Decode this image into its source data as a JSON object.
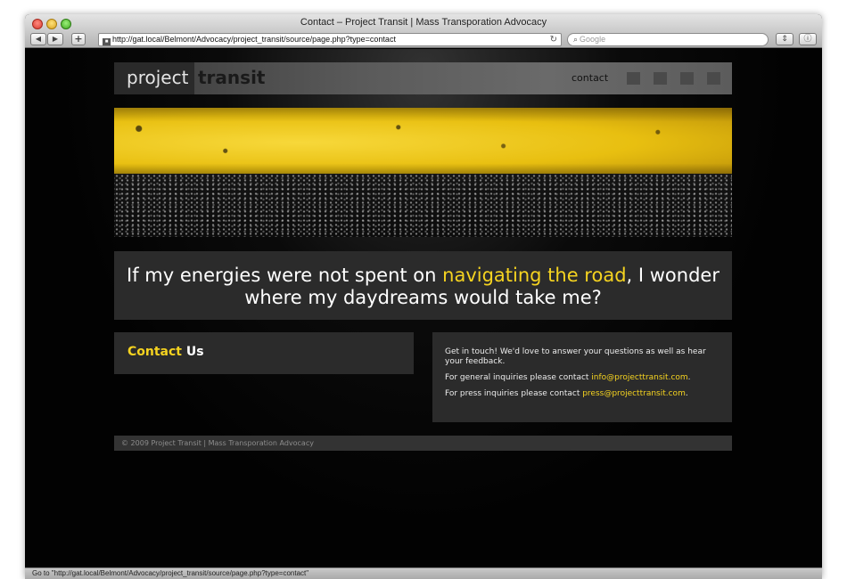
{
  "browser": {
    "window_title": "Contact – Project Transit | Mass Transporation Advocacy",
    "back_icon": "◀",
    "forward_icon": "▶",
    "add_bookmark_icon": "+",
    "url": "http://gat.local/Belmont/Advocacy/project_transit/source/page.php?type=contact",
    "search_placeholder": "Google",
    "status_text": "Go to \"http://gat.local/Belmont/Advocacy/project_transit/source/page.php?type=contact\""
  },
  "header": {
    "logo_word1": "project",
    "logo_word2": "transit",
    "nav_contact": "contact"
  },
  "quote": {
    "part1": "If my energies were not spent on ",
    "highlight": "navigating the road",
    "part2": ", I wonder where my daydreams would take me?"
  },
  "contact": {
    "heading_word1": "Contact",
    "heading_word2": "Us",
    "intro": "Get in touch! We'd love to answer your questions as well as hear your feedback.",
    "general_text": "For general inquiries please contact ",
    "general_email": "info@projecttransit.com",
    "press_text": "For press inquiries please contact ",
    "press_email": "press@projecttransit.com",
    "period": "."
  },
  "footer": {
    "text": "© 2009 Project Transit | Mass Transporation Advocacy"
  },
  "colors": {
    "accent_yellow": "#f5d320",
    "panel_bg": "#2b2b2b"
  }
}
